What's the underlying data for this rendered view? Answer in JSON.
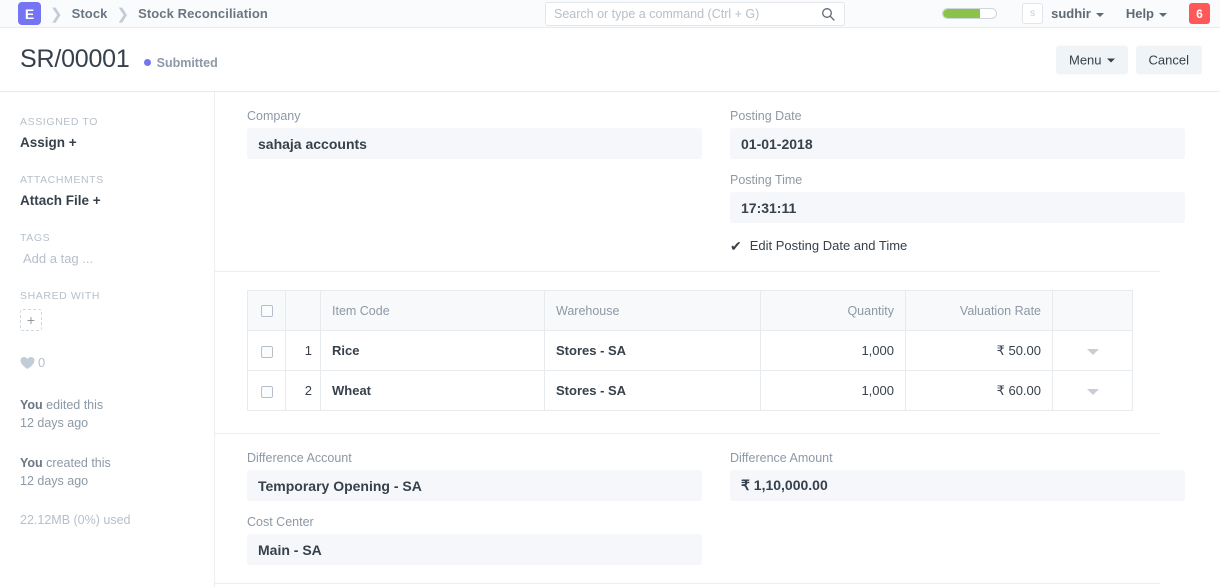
{
  "navbar": {
    "logo_letter": "E",
    "breadcrumbs": [
      "Stock",
      "Stock Reconciliation"
    ],
    "search": {
      "placeholder": "Search or type a command (Ctrl + G)",
      "value": ""
    },
    "progress_percent": 70,
    "avatar_letter": "s",
    "user_label": "sudhir",
    "help_label": "Help",
    "notification_count": "6",
    "accent_color": "#7575f3",
    "badge_color": "#ff5858",
    "progress_color": "#8bc34a"
  },
  "titlebar": {
    "doc_name": "SR/00001",
    "status_label": "Submitted",
    "status_color": "#7575f3",
    "menu_label": "Menu",
    "cancel_label": "Cancel"
  },
  "sidebar": {
    "assigned_to_heading": "ASSIGNED TO",
    "assign_label": "Assign +",
    "attachments_heading": "ATTACHMENTS",
    "attach_label": "Attach File +",
    "tags_heading": "TAGS",
    "tag_placeholder": "Add a tag ...",
    "shared_with_heading": "SHARED WITH",
    "share_add_label": "+",
    "like_count": "0",
    "activity": [
      {
        "actor": "You",
        "action": " edited this",
        "time": "12 days ago"
      },
      {
        "actor": "You",
        "action": " created this",
        "time": "12 days ago"
      }
    ],
    "usage_text": "22.12MB (0%) used"
  },
  "form": {
    "company": {
      "label": "Company",
      "value": "sahaja accounts"
    },
    "posting_date": {
      "label": "Posting Date",
      "value": "01-01-2018"
    },
    "posting_time": {
      "label": "Posting Time",
      "value": "17:31:11"
    },
    "edit_posting": {
      "label": "Edit Posting Date and Time",
      "checked": true
    },
    "difference_account": {
      "label": "Difference Account",
      "value": "Temporary Opening - SA"
    },
    "cost_center": {
      "label": "Cost Center",
      "value": "Main - SA"
    },
    "difference_amount": {
      "label": "Difference Amount",
      "value": "₹ 1,10,000.00"
    }
  },
  "items_grid": {
    "columns": [
      "",
      "",
      "Item Code",
      "Warehouse",
      "Quantity",
      "Valuation Rate",
      ""
    ],
    "headers": {
      "item_code": "Item Code",
      "warehouse": "Warehouse",
      "quantity": "Quantity",
      "valuation_rate": "Valuation Rate"
    },
    "rows": [
      {
        "index": "1",
        "item_code": "Rice",
        "warehouse": "Stores - SA",
        "quantity": "1,000",
        "valuation_rate": "₹ 50.00"
      },
      {
        "index": "2",
        "item_code": "Wheat",
        "warehouse": "Stores - SA",
        "quantity": "1,000",
        "valuation_rate": "₹ 60.00"
      }
    ]
  }
}
